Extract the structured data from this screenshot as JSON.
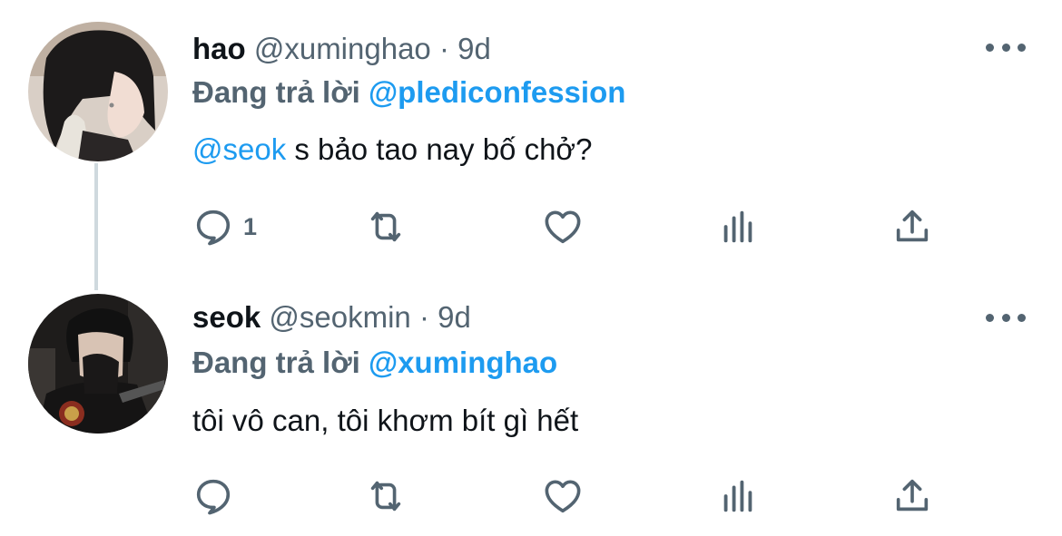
{
  "tweets": [
    {
      "name": "hao",
      "handle": "@xuminghao",
      "separator": "·",
      "time": "9d",
      "replying_prefix": "Đang trả lời ",
      "replying_to": "@plediconfession",
      "text_mention": "@seok",
      "text_rest": " s bảo tao nay bố chở?",
      "reply_count": "1",
      "icons": [
        "reply-icon",
        "retweet-icon",
        "like-icon",
        "analytics-icon",
        "share-icon",
        "more-icon"
      ]
    },
    {
      "name": "seok",
      "handle": "@seokmin",
      "separator": "·",
      "time": "9d",
      "replying_prefix": "Đang trả lời ",
      "replying_to": "@xuminghao",
      "text_mention": "",
      "text_rest": "tôi vô can, tôi khơm bít gì hết",
      "reply_count": "",
      "icons": [
        "reply-icon",
        "retweet-icon",
        "like-icon",
        "analytics-icon",
        "share-icon",
        "more-icon"
      ]
    }
  ],
  "colors": {
    "link": "#1d9bf0",
    "secondary": "#536471",
    "text": "#0f1419",
    "thread_line": "#cfd9de"
  }
}
